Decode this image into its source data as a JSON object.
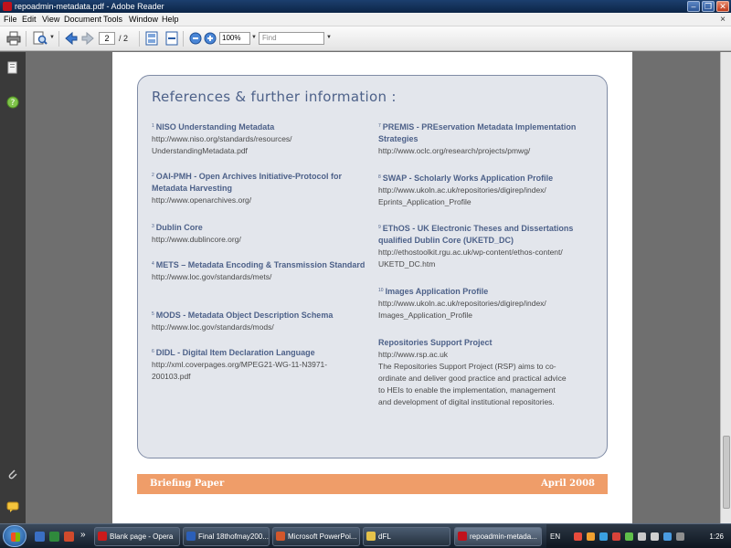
{
  "window": {
    "title": "repoadmin-metadata.pdf - Adobe Reader",
    "min": "–",
    "max": "❐",
    "close": "✕"
  },
  "menu": [
    "File",
    "Edit",
    "View",
    "Document",
    "Tools",
    "Window",
    "Help"
  ],
  "menu_close": "×",
  "toolbar": {
    "page_current": "2",
    "page_total": "/ 2",
    "zoom": "100%",
    "find_placeholder": "Find"
  },
  "document": {
    "heading": "References & further information :",
    "left_refs": [
      {
        "num": "1",
        "title": "NISO Understanding Metadata",
        "lines": [
          "http://www.niso.org/standards/resources/",
          "UnderstandingMetadata.pdf"
        ]
      },
      {
        "num": "2",
        "title": "OAI-PMH - Open Archives Initiative-Protocol for Metadata Harvesting",
        "lines": [
          "http://www.openarchives.org/"
        ]
      },
      {
        "num": "3",
        "title": "Dublin Core",
        "lines": [
          "http://www.dublincore.org/"
        ]
      },
      {
        "num": "4",
        "title": "METS – Metadata Encoding & Transmission Standard",
        "lines": [
          "http://www.loc.gov/standards/mets/"
        ]
      },
      {
        "num": "5",
        "title": "MODS - Metadata Object Description Schema",
        "lines": [
          "http://www.loc.gov/standards/mods/"
        ]
      },
      {
        "num": "6",
        "title": "DIDL - Digital Item Declaration Language",
        "lines": [
          "http://xml.coverpages.org/MPEG21-WG-11-N3971-",
          "200103.pdf"
        ]
      }
    ],
    "right_refs": [
      {
        "num": "7",
        "title": "PREMIS - PREservation Metadata Implementation Strategies",
        "lines": [
          "http://www.oclc.org/research/projects/pmwg/"
        ]
      },
      {
        "num": "8",
        "title": "SWAP - Scholarly Works Application Profile",
        "lines": [
          "http://www.ukoln.ac.uk/repositories/digirep/index/",
          "Eprints_Application_Profile"
        ]
      },
      {
        "num": "9",
        "title": "EThOS - UK Electronic Theses and Dissertations qualified Dublin Core (UKETD_DC)",
        "lines": [
          "http://ethostoolkit.rgu.ac.uk/wp-content/ethos-content/",
          "UKETD_DC.htm"
        ]
      },
      {
        "num": "10",
        "title": "Images Application Profile",
        "lines": [
          "http://www.ukoln.ac.uk/repositories/digirep/index/",
          "Images_Application_Profile"
        ]
      }
    ],
    "rsp": {
      "title": "Repositories Support Project",
      "url": "http://www.rsp.ac.uk",
      "desc": [
        "The Repositories Support Project (RSP) aims to co-",
        "ordinate and deliver good practice and practical advice",
        "to HEIs to enable the implementation, management",
        "and development of digital institutional repositories."
      ]
    },
    "footer_left": "Briefing Paper",
    "footer_right": "April 2008"
  },
  "taskbar": {
    "chevron": "»",
    "buttons": [
      "Blank page - Opera",
      "Final 18thofmay200...",
      "Microsoft PowerPoi...",
      "dFL",
      "repoadmin-metada..."
    ],
    "lang": "EN",
    "clock": "1:26"
  },
  "colors": {
    "heading": "#4d6189",
    "box_bg": "#e3e6ec",
    "footer": "#ef9d69",
    "titlebar": "#0c2547"
  }
}
